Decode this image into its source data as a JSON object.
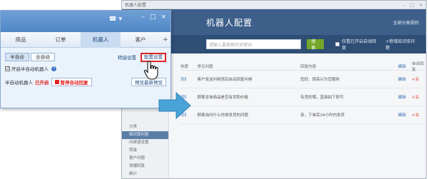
{
  "config_window": {
    "title": "机器人配置",
    "header_title": "机器人配置",
    "header_link": "全部分类规则",
    "search_placeholder": "请输入要搜索的关键词",
    "search_button": "搜索",
    "filter_label": "仅看已开启自动回复",
    "add_link": "+新增知识库问题",
    "sidebar": {
      "items": [
        {
          "label": "分类"
        },
        {
          "label": "知识库问答"
        },
        {
          "label": "问候语设置"
        },
        {
          "label": "转接"
        },
        {
          "label": "客户问题"
        },
        {
          "label": "快捷回复"
        },
        {
          "label": "统计"
        }
      ],
      "active_index": 1
    },
    "table": {
      "headers": [
        "热度",
        "常见问题",
        "回复内容",
        "编辑",
        "自动回复"
      ],
      "rows": [
        {
          "hot": "||||||",
          "question": "客户发送问候语后自动回复问候",
          "answer": "您好，很高兴为您服务",
          "edit": "编辑",
          "auto": "✔关"
        },
        {
          "hot": "||||||",
          "question": "顾客咨询商品是否有货和价格",
          "answer": "有货的哦，直接拍下即可",
          "edit": "编辑",
          "auto": "✔关"
        },
        {
          "hot": "||||||",
          "question": "顾客询问什么时候发货的问题",
          "answer": "亲，下单后24小时内发货",
          "edit": "编辑",
          "auto": "✔关"
        }
      ]
    }
  },
  "robot_window": {
    "tabs": [
      {
        "label": "商品"
      },
      {
        "label": "订单"
      },
      {
        "label": "机器人"
      },
      {
        "label": "客户"
      }
    ],
    "active_tab": 2,
    "mode_semi": "半自动",
    "mode_full": "全自动",
    "transfer_link": "转接设置",
    "config_button": "配置设置",
    "checkbox_label": "开启半自动机器人",
    "checkbox_checked": "☑",
    "status_prefix": "半自动机器人",
    "status_value": "已开启",
    "pause_button": "暂停自动回复",
    "preview_button": "预览最新预览"
  },
  "colors": {
    "accent_red": "#e02424",
    "header_blue": "#3d5f8a",
    "arrow_blue": "#4aa3d8"
  }
}
